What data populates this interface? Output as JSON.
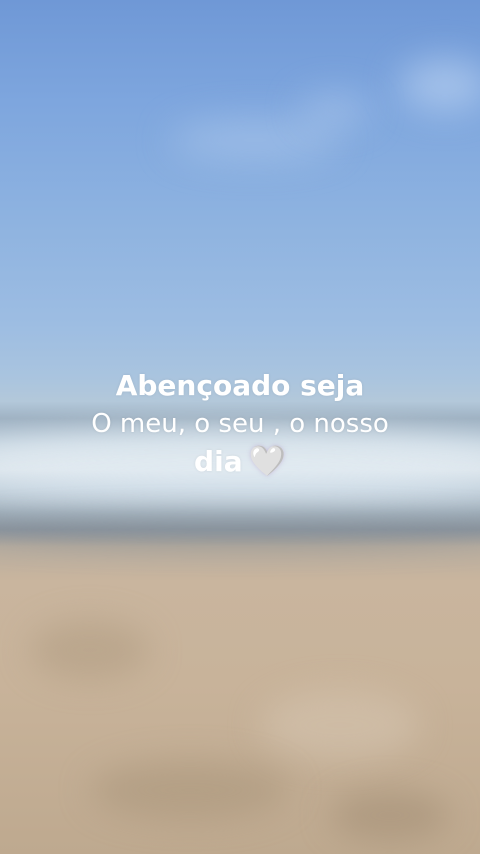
{
  "caption": {
    "line_1": "Abençoado seja",
    "line_2": "O meu, o seu , o nosso",
    "line_3_word": "dia",
    "line_3_emoji": "🤍"
  },
  "colors": {
    "sky": "#7ea6de",
    "sea_foam": "#d6e0e8",
    "sand": "#c8b39a",
    "text": "#ffffff"
  }
}
